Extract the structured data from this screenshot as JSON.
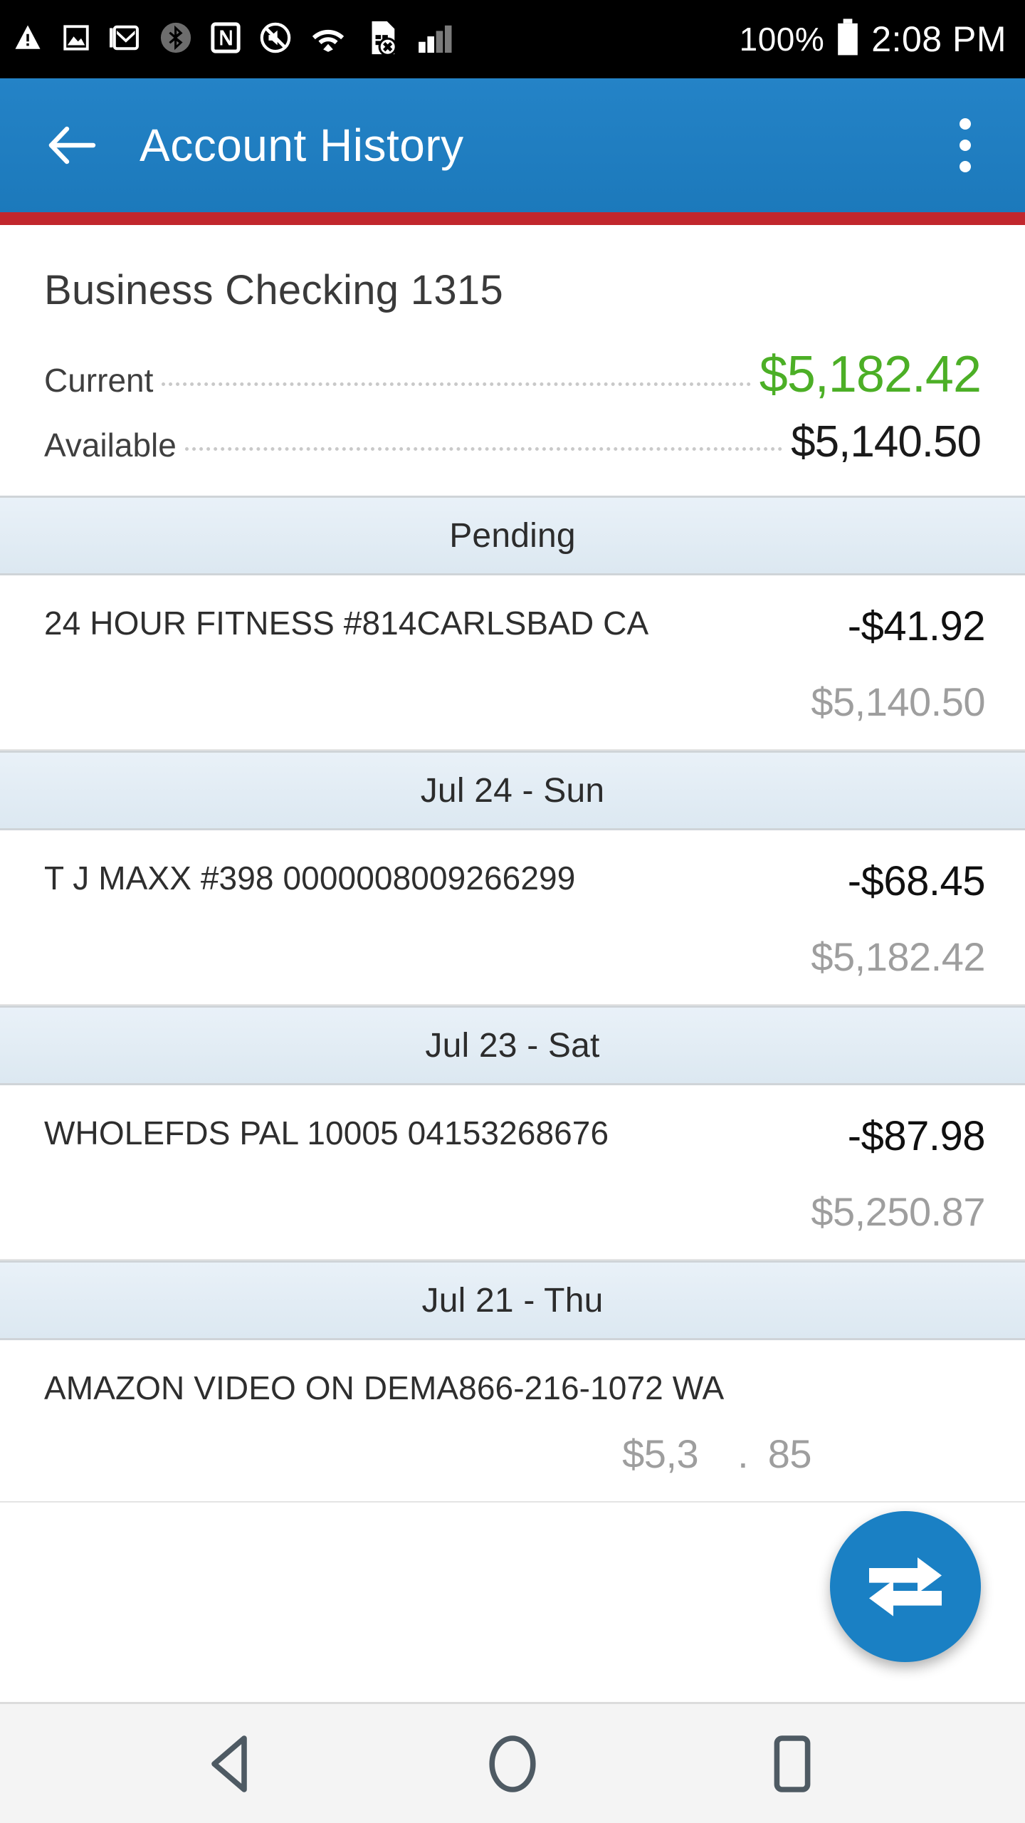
{
  "status_bar": {
    "icons": [
      "warning-triangle-icon",
      "image-icon",
      "gmail-icon",
      "bluetooth-icon",
      "nfc-icon",
      "mute-icon",
      "wifi-icon",
      "sim-card-error-icon",
      "signal-bars-icon"
    ],
    "battery_percent": "100%",
    "battery_icon": "battery-full-icon",
    "time": "2:08 PM"
  },
  "app_bar": {
    "back_icon": "back-arrow-icon",
    "title": "Account History",
    "overflow_icon": "overflow-menu-icon",
    "background_color": "#1c79bb",
    "accent_stripe_color": "#c1272d"
  },
  "account": {
    "name": "Business Checking 1315",
    "current_label": "Current",
    "current_value": "$5,182.42",
    "current_color": "#4caf26",
    "available_label": "Available",
    "available_value": "$5,140.50",
    "available_color": "#1a1a1a"
  },
  "sections": [
    {
      "header": "Pending",
      "transactions": [
        {
          "description": "24 HOUR FITNESS #814CARLSBAD CA",
          "amount": "-$41.92",
          "balance": "$5,140.50"
        }
      ]
    },
    {
      "header": "Jul 24 - Sun",
      "transactions": [
        {
          "description": "T J MAXX #398 0000008009266299",
          "amount": "-$68.45",
          "balance": "$5,182.42"
        }
      ]
    },
    {
      "header": "Jul 23 - Sat",
      "transactions": [
        {
          "description": "WHOLEFDS PAL 10005 04153268676",
          "amount": "-$87.98",
          "balance": "$5,250.87"
        }
      ]
    },
    {
      "header": "Jul 21 - Thu",
      "transactions": [
        {
          "description": "AMAZON VIDEO ON DEMA866-216-1072 WA",
          "amount": "",
          "balance": "$5,3  . 85"
        }
      ]
    }
  ],
  "fab": {
    "icon": "transfer-arrows-icon",
    "color": "#1a80c4"
  },
  "nav_bar": {
    "back_icon": "nav-back-triangle-icon",
    "home_icon": "nav-home-circle-icon",
    "recents_icon": "nav-recents-square-icon"
  }
}
